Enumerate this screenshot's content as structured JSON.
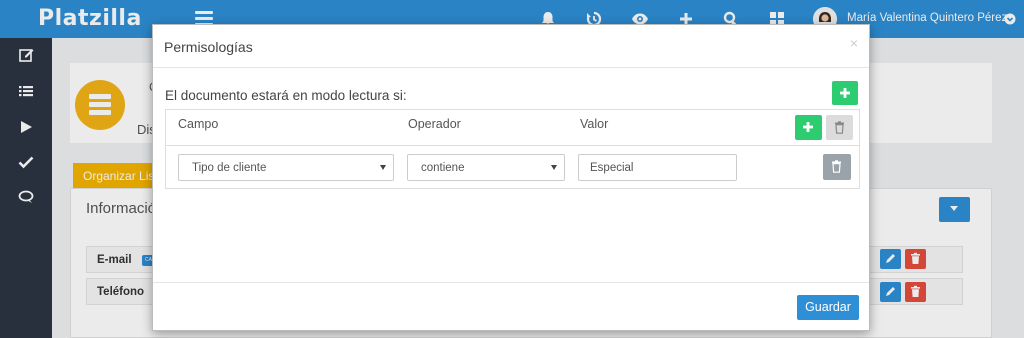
{
  "app": {
    "brand": "Platzilla",
    "user_name": "María Valentina Quintero Pérez"
  },
  "topbar": {
    "icons": [
      "bell-icon",
      "history-icon",
      "eye-icon",
      "plus-icon",
      "search-icon",
      "grid-icon"
    ]
  },
  "sidebar": {
    "items": [
      "edit-icon",
      "list-icon",
      "play-icon",
      "check-icon",
      "chat-icon"
    ]
  },
  "background": {
    "frag_c": "C",
    "frag_dis": "Dis",
    "tab_organize": "Organizar Lis",
    "info_title": "Informació",
    "rows": [
      {
        "label": "E-mail",
        "badge": "CA"
      },
      {
        "label": "Teléfono"
      }
    ]
  },
  "modal": {
    "title": "Permisologías",
    "close": "×",
    "description": "El documento estará en modo lectura si:",
    "columns": [
      "Campo",
      "Operador",
      "Valor"
    ],
    "rule": {
      "field": "Tipo de cliente",
      "operator": "contiene",
      "value": "Especial"
    },
    "save_label": "Guardar"
  },
  "colors": {
    "primary": "#2e8fd6",
    "success": "#2ecc71",
    "danger": "#e74c3c",
    "warning": "#f5b400",
    "sidebar": "#2b3542"
  }
}
